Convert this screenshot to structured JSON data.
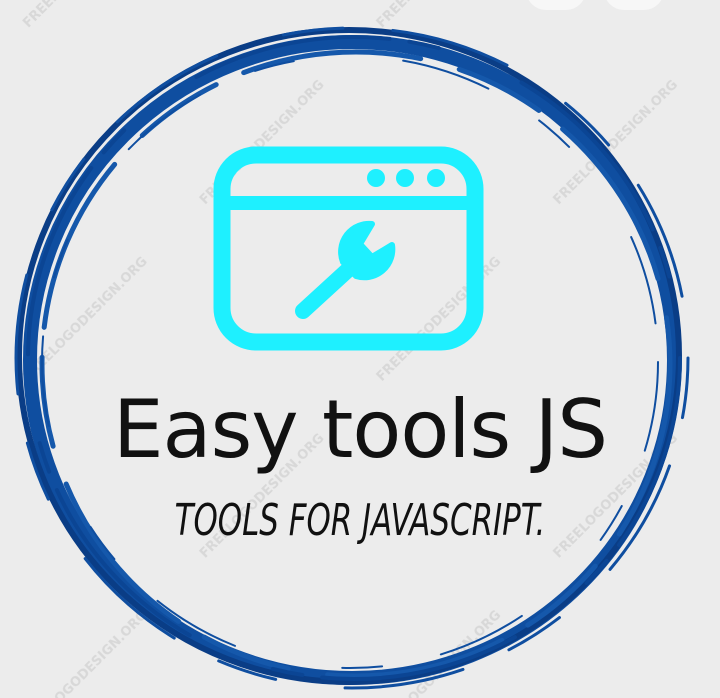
{
  "logo": {
    "title": "Easy tools JS",
    "tagline": "TOOLS FOR JAVASCRIPT.",
    "watermark_text": "FREELOGODESIGN.ORG",
    "icon": "browser-window-wrench-icon"
  },
  "colors": {
    "background": "#ececec",
    "ring": "#0f4ea0",
    "ring_dark": "#0a3d86",
    "icon": "#1ef0ff",
    "text": "#111111",
    "watermark": "#d6d6d6"
  }
}
